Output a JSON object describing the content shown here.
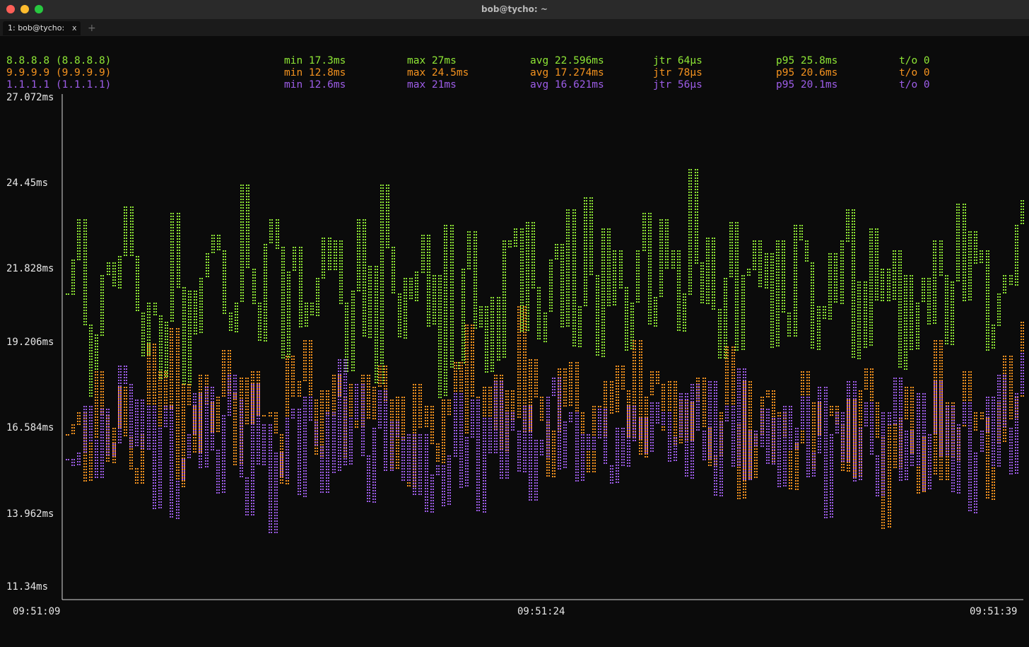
{
  "window": {
    "title": "bob@tycho: ~"
  },
  "tabs": [
    {
      "label": "1: bob@tycho:",
      "close": "x"
    }
  ],
  "new_tab": "+",
  "colors": {
    "green": "#8ee635",
    "orange": "#f5931f",
    "purple": "#9d5de8",
    "axis": "#d8d8d8"
  },
  "stats": [
    {
      "host": "8.8.8.8 (8.8.8.8)",
      "min": "min 17.3ms",
      "max": "max 27ms",
      "avg": "avg 22.596ms",
      "jtr": "jtr 64µs",
      "p95": "p95 25.8ms",
      "to": "t/o 0",
      "color": "#8ee635"
    },
    {
      "host": "9.9.9.9 (9.9.9.9)",
      "min": "min 12.8ms",
      "max": "max 24.5ms",
      "avg": "avg 17.274ms",
      "jtr": "jtr 78µs",
      "p95": "p95 20.6ms",
      "to": "t/o 0",
      "color": "#f5931f"
    },
    {
      "host": "1.1.1.1 (1.1.1.1)",
      "min": "min 12.6ms",
      "max": "max 21ms",
      "avg": "avg 16.621ms",
      "jtr": "jtr 56µs",
      "p95": "p95 20.1ms",
      "to": "t/o 0",
      "color": "#9d5de8"
    }
  ],
  "chart_data": {
    "type": "line",
    "y_tick_labels": [
      "27.072ms",
      "24.45ms",
      "21.828ms",
      "19.206ms",
      "16.584ms",
      "13.962ms",
      "11.34ms"
    ],
    "y_ticks": [
      27.072,
      24.45,
      21.828,
      19.206,
      16.584,
      13.962,
      11.34
    ],
    "ylim": [
      11.34,
      27.072
    ],
    "x_tick_labels": [
      "09:51:09",
      "09:51:24",
      "09:51:39"
    ],
    "series": [
      {
        "name": "8.8.8.8 (8.8.8.8)",
        "color": "#8ee635",
        "values": [
          20.8,
          21.9,
          23.2,
          19.8,
          17.5,
          19.5,
          21.4,
          21.8,
          21.0,
          22.0,
          23.6,
          22.0,
          20.2,
          18.8,
          20.5,
          20.1,
          18.1,
          19.9,
          23.4,
          21.0,
          17.9,
          20.9,
          19.5,
          21.3,
          22.1,
          22.7,
          22.2,
          20.2,
          19.6,
          20.5,
          24.3,
          21.6,
          20.5,
          19.3,
          22.4,
          23.2,
          22.3,
          18.7,
          21.5,
          22.3,
          19.7,
          20.5,
          20.1,
          21.3,
          22.6,
          21.6,
          22.5,
          20.5,
          18.3,
          20.9,
          23.2,
          19.4,
          21.7,
          17.9,
          24.3,
          22.3,
          20.8,
          19.4,
          21.3,
          20.6,
          21.5,
          22.7,
          19.8,
          21.4,
          17.5,
          23.0,
          18.4,
          18.6,
          21.6,
          22.8,
          19.7,
          20.4,
          18.3,
          20.7,
          18.7,
          22.5,
          22.3,
          22.9,
          19.6,
          23.1,
          21.0,
          19.3,
          20.2,
          21.9,
          22.4,
          19.7,
          23.5,
          19.1,
          20.4,
          23.9,
          21.4,
          18.8,
          22.9,
          20.4,
          22.2,
          21.0,
          19.0,
          20.5,
          22.2,
          23.4,
          19.8,
          20.7,
          23.2,
          21.6,
          22.2,
          19.6,
          20.8,
          24.8,
          21.8,
          20.5,
          22.6,
          20.3,
          18.7,
          21.3,
          23.1,
          19.0,
          21.4,
          21.6,
          22.5,
          21.0,
          22.1,
          19.1,
          22.5,
          20.2,
          19.4,
          23.0,
          22.5,
          21.8,
          19.0,
          20.4,
          20.0,
          22.1,
          20.5,
          22.5,
          23.5,
          18.7,
          21.2,
          19.1,
          22.9,
          20.6,
          21.6,
          20.6,
          22.2,
          18.4,
          21.4,
          19.0,
          20.5,
          21.3,
          19.8,
          22.5,
          21.4,
          19.2,
          21.2,
          23.7,
          20.6,
          22.8,
          21.8,
          22.2,
          19.0,
          19.8,
          20.8,
          21.4,
          21.1,
          23.0,
          23.8
        ]
      },
      {
        "name": "9.9.9.9 (9.9.9.9)",
        "color": "#f5931f",
        "values": [
          16.3,
          16.6,
          17.0,
          14.8,
          16.2,
          18.3,
          16.9,
          15.4,
          16.5,
          17.8,
          16.2,
          15.2,
          14.7,
          16.3,
          19.2,
          15.0,
          18.3,
          17.1,
          19.7,
          14.6,
          17.9,
          17.2,
          15.7,
          18.2,
          17.3,
          16.4,
          17.5,
          19.0,
          17.6,
          15.3,
          18.1,
          16.6,
          18.3,
          16.9,
          16.9,
          17.0,
          16.3,
          14.7,
          18.8,
          17.5,
          18.0,
          19.3,
          17.4,
          15.6,
          17.7,
          16.9,
          18.2,
          17.5,
          15.6,
          17.9,
          16.5,
          18.2,
          16.8,
          17.8,
          18.5,
          17.4,
          15.2,
          17.5,
          16.1,
          14.6,
          17.9,
          16.5,
          17.2,
          16.0,
          15.4,
          17.4,
          16.9,
          18.6,
          16.3,
          19.8,
          17.5,
          15.1,
          17.8,
          16.4,
          18.2,
          15.8,
          17.7,
          16.8,
          20.4,
          16.4,
          18.7,
          17.5,
          16.7,
          14.9,
          16.4,
          18.4,
          17.2,
          18.6,
          17.0,
          16.3,
          15.1,
          17.2,
          16.2,
          18.0,
          17.0,
          18.5,
          17.7,
          16.2,
          19.3,
          15.6,
          17.5,
          18.3,
          17.9,
          16.4,
          18.0,
          16.0,
          17.4,
          16.1,
          17.3,
          18.1,
          16.5,
          15.3,
          15.6,
          17.0,
          19.1,
          16.6,
          14.2,
          18.0,
          14.9,
          16.3,
          17.5,
          17.7,
          15.4,
          17.0,
          16.2,
          14.5,
          16.0,
          18.3,
          15.2,
          17.3,
          16.3,
          16.9,
          17.2,
          16.6,
          15.1,
          17.4,
          14.9,
          17.7,
          18.4,
          17.3,
          16.2,
          13.3,
          16.6,
          15.2,
          16.8,
          17.8,
          15.7,
          14.4,
          16.2,
          15.0,
          19.3,
          14.8,
          17.3,
          15.5,
          16.5,
          18.3,
          16.4,
          17.0,
          16.8,
          14.2,
          17.3,
          16.0,
          18.8,
          16.8,
          17.5,
          19.9
        ]
      },
      {
        "name": "1.1.1.1 (1.1.1.1)",
        "color": "#9d5de8",
        "values": [
          15.5,
          15.3,
          15.7,
          17.2,
          16.1,
          14.9,
          17.1,
          15.6,
          16.0,
          18.5,
          17.9,
          15.9,
          17.4,
          15.8,
          17.2,
          13.9,
          16.5,
          17.2,
          13.6,
          14.8,
          15.5,
          16.3,
          17.6,
          15.2,
          17.8,
          15.8,
          14.4,
          16.9,
          18.2,
          17.4,
          14.9,
          13.7,
          17.9,
          15.3,
          16.6,
          13.1,
          15.7,
          14.9,
          16.8,
          17.1,
          14.3,
          17.5,
          16.7,
          15.9,
          14.4,
          17.0,
          15.1,
          18.7,
          15.3,
          16.8,
          17.9,
          15.6,
          14.1,
          16.5,
          17.7,
          15.1,
          16.7,
          16.2,
          14.8,
          16.3,
          14.4,
          16.3,
          13.8,
          15.0,
          15.3,
          14.0,
          15.6,
          17.6,
          14.6,
          16.2,
          17.4,
          13.8,
          16.8,
          15.7,
          18.0,
          14.9,
          17.0,
          16.4,
          15.1,
          17.2,
          14.2,
          16.1,
          15.6,
          17.5,
          18.1,
          15.2,
          16.7,
          17.0,
          14.8,
          16.3,
          15.8,
          16.2,
          17.1,
          15.3,
          14.7,
          16.5,
          15.3,
          17.2,
          16.1,
          16.8,
          15.7,
          17.3,
          16.6,
          17.0,
          15.4,
          16.2,
          17.6,
          14.9,
          17.9,
          16.4,
          15.5,
          18.0,
          14.3,
          16.7,
          17.2,
          15.3,
          18.4,
          14.8,
          16.4,
          15.9,
          17.1,
          15.3,
          16.8,
          14.6,
          17.2,
          15.8,
          16.5,
          17.5,
          14.9,
          15.7,
          17.8,
          13.6,
          16.3,
          17.0,
          15.4,
          18.0,
          14.8,
          16.5,
          17.3,
          15.6,
          14.3,
          17.0,
          16.6,
          18.1,
          14.8,
          16.4,
          15.3,
          17.6,
          14.5,
          16.3,
          18.0,
          15.6,
          17.2,
          14.4,
          16.6,
          17.3,
          13.8,
          15.7,
          16.4,
          17.5,
          15.3,
          18.2,
          16.5,
          15.0,
          17.6,
          18.9
        ]
      }
    ]
  }
}
